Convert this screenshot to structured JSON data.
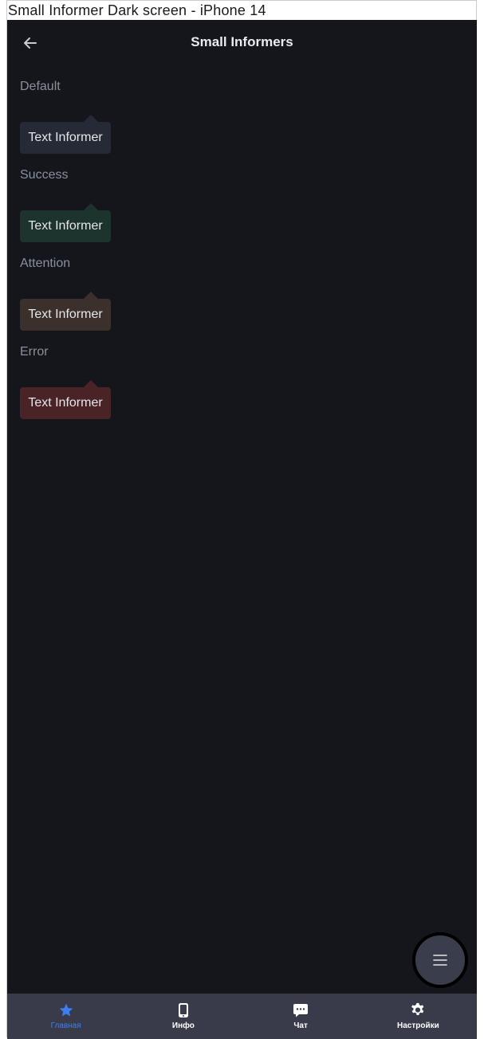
{
  "window": {
    "title": "Small Informer Dark screen - iPhone 14"
  },
  "nav": {
    "title": "Small Informers",
    "back_icon": "arrow-left-icon"
  },
  "sections": [
    {
      "label": "Default",
      "informer_text": "Text Informer",
      "color": "#262a36"
    },
    {
      "label": "Success",
      "informer_text": "Text Informer",
      "color": "#1d332e"
    },
    {
      "label": "Attention",
      "informer_text": "Text Informer",
      "color": "#3b302b"
    },
    {
      "label": "Error",
      "informer_text": "Text Informer",
      "color": "#4a2327"
    }
  ],
  "fab": {
    "icon": "menu-icon"
  },
  "tabs": [
    {
      "label": "Главная",
      "icon": "star-icon",
      "active": true
    },
    {
      "label": "Инфо",
      "icon": "phone-icon",
      "active": false
    },
    {
      "label": "Чат",
      "icon": "chat-icon",
      "active": false
    },
    {
      "label": "Настройки",
      "icon": "gear-icon",
      "active": false
    }
  ],
  "colors": {
    "background": "#14161c",
    "tab_bar": "#393b4a",
    "accent": "#3d7ff0"
  }
}
